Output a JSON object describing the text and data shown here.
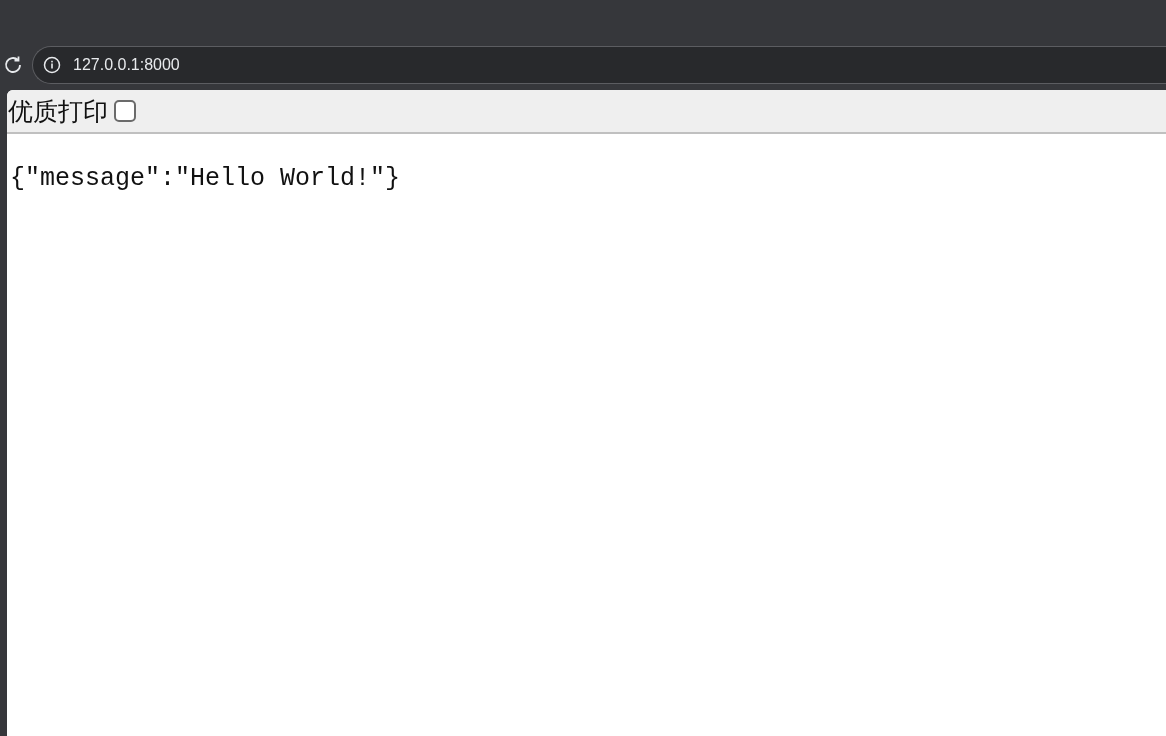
{
  "address_bar": {
    "url": "127.0.0.1:8000"
  },
  "toolbar": {
    "label": "优质打印",
    "checked": false
  },
  "body": {
    "text": "{\"message\":\"Hello World!\"}"
  }
}
